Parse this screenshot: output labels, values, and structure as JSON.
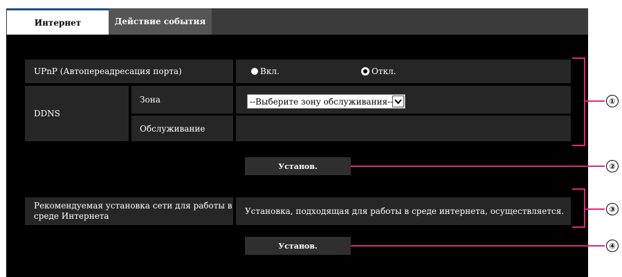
{
  "tabs": [
    {
      "label": "Интернет",
      "active": true
    },
    {
      "label": "Действие события",
      "active": false
    }
  ],
  "upnp": {
    "label": "UPnP (Автопереадресация порта)",
    "options": [
      "Вкл.",
      "Откл."
    ],
    "selected": "Откл."
  },
  "ddns": {
    "label": "DDNS",
    "zone_label": "Зона",
    "zone_select_value": "--Выберите зону обслуживания--",
    "service_label": "Обслуживание"
  },
  "set_button_1": "Установ.",
  "recommended": {
    "label": "Рекомендуемая установка сети для работы в среде Интернета",
    "description": "Установка, подходящая для работы в среде интернета, осуществляется."
  },
  "set_button_2": "Установ.",
  "callouts": [
    "①",
    "②",
    "③",
    "④"
  ],
  "colors": {
    "accent": "#e0287a",
    "tab_active_border": "#1f4f7a",
    "cell_bg": "#262626"
  }
}
